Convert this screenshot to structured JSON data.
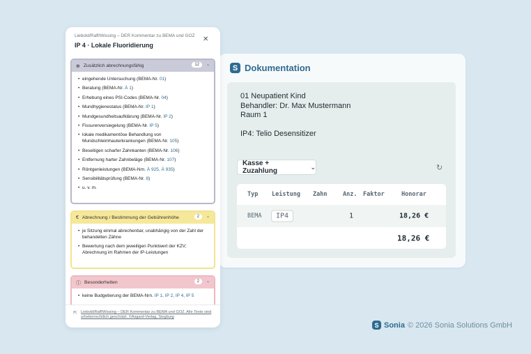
{
  "documentation": {
    "title": "Dokumentation",
    "patient_lines": [
      "01 Neupatient Kind",
      "Behandler: Dr. Max Mustermann",
      "Raum 1"
    ],
    "service": "IP4: Telio Desensitizer",
    "billing_select": "Kasse + Zuzahlung",
    "table": {
      "headers": [
        "Typ",
        "Leistung",
        "Zahn",
        "Anz.",
        "Faktor",
        "Honorar"
      ],
      "row": {
        "typ": "BEMA",
        "leistung": "IP4",
        "zahn": "",
        "anz": "1",
        "faktor": "",
        "honorar": "18,26 €"
      },
      "total": "18,26 €"
    }
  },
  "brand": {
    "name": "Sonia",
    "copyright": "© 2026 Sonia Solutions GmbH"
  },
  "panel": {
    "subtitle": "Liebold/Raff/Wissing – DER Kommentar zu BEMA und GOZ",
    "title": "IP 4 · Lokale Fluoridierung",
    "sections": [
      {
        "title": "Zusätzlich abrechnungsfähig",
        "count": "12",
        "items": [
          {
            "text": "eingehende Untersuchung (BEMA-Nr. ",
            "ref": "01",
            "post": ")"
          },
          {
            "text": "Beratung (BEMA-Nr. ",
            "ref": "Ä 1",
            "post": ")"
          },
          {
            "text": "Erhebung eines PSI-Codes (BEMA-Nr. ",
            "ref": "04",
            "post": ")"
          },
          {
            "text": "Mundhygienestatus (BEMA-Nr. ",
            "ref": "IP 1",
            "post": ")"
          },
          {
            "text": "Mundgesundheitsaufklärung (BEMA-Nr. ",
            "ref": "IP 2",
            "post": ")"
          },
          {
            "text": "Fissurenversiegelung (BEMA-Nr. ",
            "ref": "IP 5",
            "post": ")"
          },
          {
            "text": "lokale medikamentöse Behandlung von Mundschleimhauterkrankungen (BEMA-Nr. ",
            "ref": "105",
            "post": ")"
          },
          {
            "text": "Beseitigen scharfer Zahnkanten (BEMA-Nr. ",
            "ref": "106",
            "post": ")"
          },
          {
            "text": "Entfernung harter Zahnbeläge (BEMA-Nr. ",
            "ref": "107",
            "post": ")"
          },
          {
            "text": "Röntgenleistungen (BEMA-Nrn. ",
            "ref": "Ä 925, Ä 935",
            "post": ")"
          },
          {
            "text": "Sensibilitätsprüfung (BEMA-Nr. ",
            "ref": "8",
            "post": ")"
          },
          {
            "text": "u. v. m.",
            "ref": "",
            "post": ""
          }
        ]
      },
      {
        "title": "Abrechnung / Bestimmung der Gebührenhöhe",
        "count": "2",
        "items": [
          {
            "text": "je Sitzung einmal abrechenbar, unabhängig von der Zahl der behandelten Zähne",
            "ref": "",
            "post": ""
          },
          {
            "text": "Bewertung nach dem jeweiligen Punktwert der KZV; Abrechnung im Rahmen der IP-Leistungen",
            "ref": "",
            "post": ""
          }
        ]
      },
      {
        "title": "Besonderheiten",
        "count": "2",
        "items": [
          {
            "text": "keine Budgetierung der BEMA-Nrn. ",
            "ref": "IP 1, IP 2, IP 4, IP 5",
            "post": ""
          }
        ]
      }
    ],
    "footer": "Liebold/Raff/Wissing – DER Kommentar zu BEMA und GOZ. Alle Texte sind urheberrechtlich geschützt. ©Asgard-Verlag, Siegburg"
  }
}
